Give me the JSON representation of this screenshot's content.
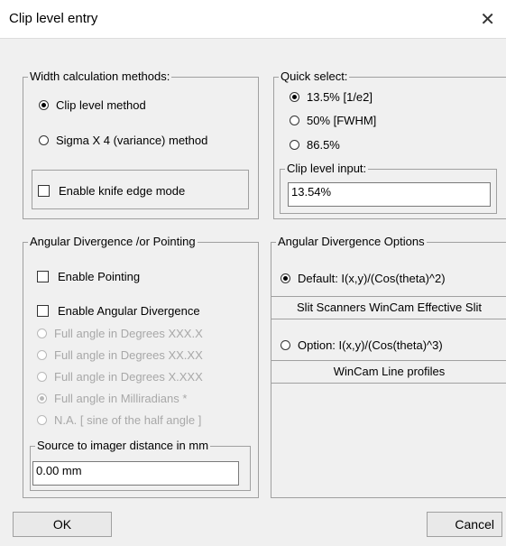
{
  "window": {
    "title": "Clip level entry",
    "close_glyph": "✕"
  },
  "width_methods": {
    "legend": "Width calculation methods:",
    "options": [
      {
        "label": "Clip level method",
        "selected": true
      },
      {
        "label": "Sigma X 4 (variance) method",
        "selected": false
      }
    ],
    "knife_edge": {
      "label": "Enable knife edge mode",
      "checked": false
    }
  },
  "quick_select": {
    "legend": "Quick select:",
    "options": [
      {
        "label": "13.5% [1/e2]",
        "selected": true
      },
      {
        "label": "50% [FWHM]",
        "selected": false
      },
      {
        "label": "86.5%",
        "selected": false
      }
    ],
    "clip_input": {
      "legend": "Clip level input:",
      "value": "13.54%"
    }
  },
  "angular_pointing": {
    "legend": "Angular Divergence /or Pointing",
    "enable_pointing": {
      "label": "Enable Pointing",
      "checked": false
    },
    "enable_divergence": {
      "label": "Enable Angular Divergence",
      "checked": false
    },
    "options": [
      {
        "label": "Full angle in Degrees XXX.X",
        "selected": false
      },
      {
        "label": "Full angle in Degrees XX.XX",
        "selected": false
      },
      {
        "label": "Full angle in Degrees X.XXX",
        "selected": false
      },
      {
        "label": "Full angle in Milliradians  *",
        "selected": true
      },
      {
        "label": "N.A.  [ sine of the half angle ]",
        "selected": false
      }
    ],
    "distance": {
      "legend": "Source to imager distance in mm",
      "value": "0.00 mm"
    }
  },
  "divergence_options": {
    "legend": "Angular Divergence Options",
    "default": {
      "label": "Default: I(x,y)/(Cos(theta)^2)",
      "selected": true
    },
    "default_button": "Slit Scanners  WinCam Effective Slit",
    "option": {
      "label": "Option: I(x,y)/(Cos(theta)^3)",
      "selected": false
    },
    "option_button": "WinCam Line profiles"
  },
  "buttons": {
    "ok": "OK",
    "cancel": "Cancel"
  }
}
